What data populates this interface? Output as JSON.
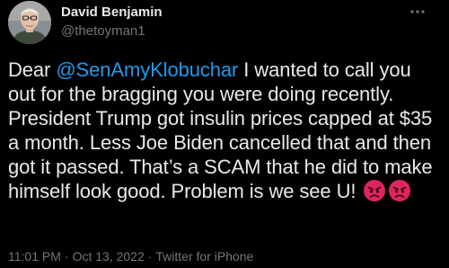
{
  "author": {
    "name": "David Benjamin",
    "handle": "@thetoyman1"
  },
  "tweet": {
    "text_before": "Dear ",
    "mention": "@SenAmyKlobuchar",
    "text_after": " I wanted to call you out for the bragging you were doing recently. President Trump got insulin prices capped at $35 a month. Less Joe Biden cancelled that and then got it passed. That’s a SCAM that he did to make himself look good. Problem is we see U! ",
    "emojis": [
      "angry-face",
      "angry-face"
    ]
  },
  "meta": {
    "time": "11:01 PM",
    "date": "Oct 13, 2022",
    "source": "Twitter for iPhone",
    "separator": "·"
  },
  "colors": {
    "background": "#000000",
    "text": "#e7e9ea",
    "secondary": "#71767b",
    "accent": "#1d9bf0",
    "emoji": "#e0245e"
  },
  "icons": {
    "more": "more-horizontal-icon"
  }
}
